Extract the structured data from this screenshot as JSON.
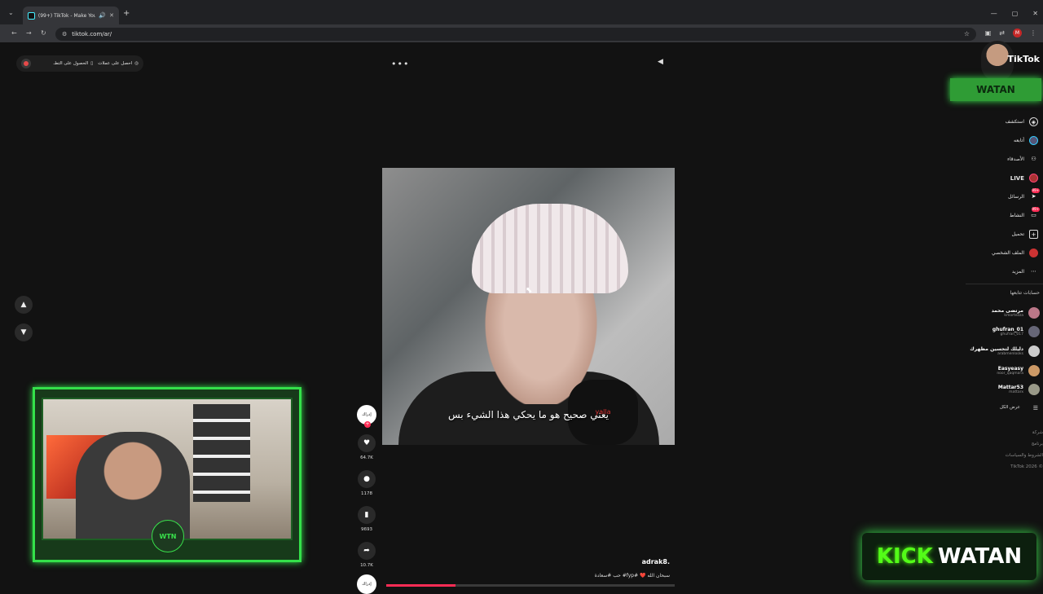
{
  "browser": {
    "tab_title": "(99+) TikTok - Make Your Day",
    "url": "tiktok.com/ar/",
    "profile_letter": "M"
  },
  "topbar": {
    "get_coins": "احصل على عملات",
    "get_app": "الحصول على التطـ"
  },
  "video": {
    "subtitle": "يعني صحيح هو ما يحكي هذا الشيء بس",
    "mic_label": "yalla",
    "author": "adrak8.",
    "caption": "سبحان الله ❤️ #fyp# حب #سعادة",
    "progress": 0.24
  },
  "actions": {
    "avatar_label": "إدراك",
    "likes": "64.7K",
    "comments": "1178",
    "saves": "9693",
    "shares": "10.7K"
  },
  "sidebar": {
    "brand_word": "TikTok",
    "brand_overlay": "WATAN",
    "menu": [
      {
        "label": "استكشف",
        "icon": "compass-icon"
      },
      {
        "label": "أتابعه",
        "icon": "following-icon"
      },
      {
        "label": "الأصدقاء",
        "icon": "friends-icon"
      },
      {
        "label": "LIVE",
        "icon": "live-icon"
      },
      {
        "label": "الرسائل",
        "icon": "messages-icon",
        "badge": "99+"
      },
      {
        "label": "النشاط",
        "icon": "activity-icon",
        "badge": "99+"
      },
      {
        "label": "تحميل",
        "icon": "upload-icon"
      },
      {
        "label": "الملف الشخصي",
        "icon": "profile-icon"
      },
      {
        "label": "المزيد",
        "icon": "more-icon"
      }
    ],
    "following_heading": "حسابات تتابعها",
    "following": [
      {
        "name": "مرتضى محمد",
        "user": "kmortezza"
      },
      {
        "name": "ghufran_01",
        "user": "ghufran_017"
      },
      {
        "name": "دليلك لتحسين مظهرك",
        "user": "arabmenlooks"
      },
      {
        "name": "Easyeasy",
        "user": "noor_qaqmara"
      },
      {
        "name": "Mattar53",
        "user": "mattarx"
      }
    ],
    "see_all": "عرض الكل",
    "footer": [
      "شركة",
      "برنامج",
      "الشروط والسياسات",
      "TikTok 2026 ©"
    ]
  },
  "overlay": {
    "kick_left": "KICK",
    "kick_right": "WATAN",
    "cam_logo": "WTN"
  }
}
